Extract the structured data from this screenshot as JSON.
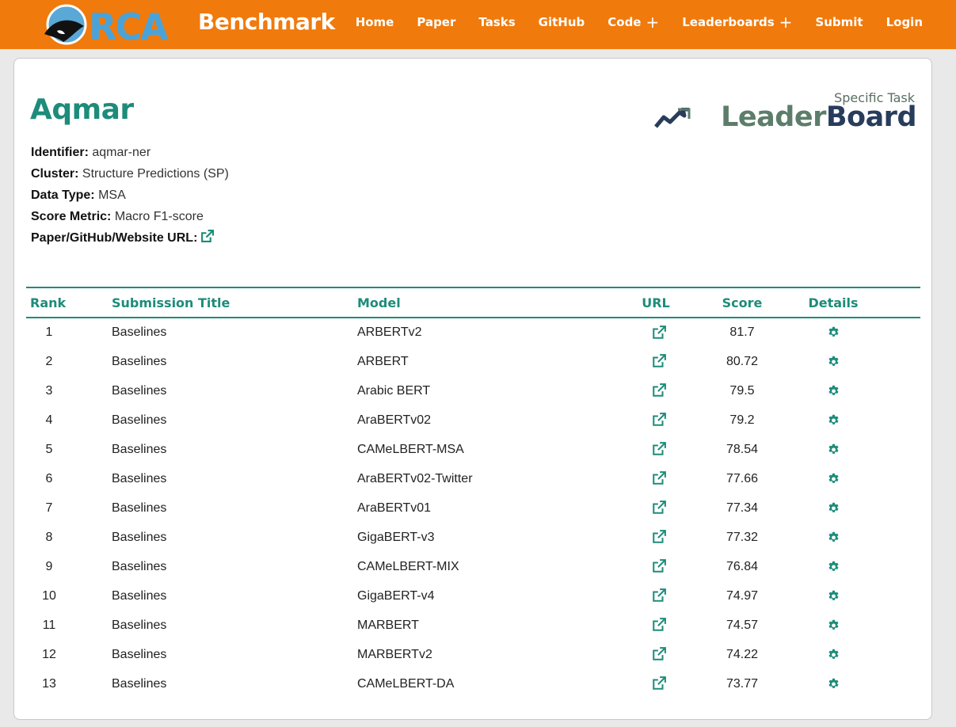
{
  "header": {
    "logo_text": "ORCA",
    "brand": "Benchmark",
    "nav": [
      {
        "label": "Home",
        "has_plus": false
      },
      {
        "label": "Paper",
        "has_plus": false
      },
      {
        "label": "Tasks",
        "has_plus": false
      },
      {
        "label": "GitHub",
        "has_plus": false
      },
      {
        "label": "Code",
        "has_plus": true
      },
      {
        "label": "Leaderboards",
        "has_plus": true
      },
      {
        "label": "Submit",
        "has_plus": false
      },
      {
        "label": "Login",
        "has_plus": false
      }
    ],
    "colors": {
      "bar": "#f07a0c",
      "text": "#ffffff"
    }
  },
  "task": {
    "title": "Aqmar",
    "fields": [
      {
        "label": "Identifier:",
        "value": "aqmar-ner"
      },
      {
        "label": "Cluster:",
        "value": "Structure Predictions (SP)"
      },
      {
        "label": "Data Type:",
        "value": "MSA"
      },
      {
        "label": "Score Metric:",
        "value": "Macro F1-score"
      },
      {
        "label": "Paper/GitHub/Website URL:",
        "value": ""
      }
    ]
  },
  "badge": {
    "small": "Specific Task",
    "word1": "Leader",
    "word2": "Board"
  },
  "table": {
    "headers": {
      "rank": "Rank",
      "title": "Submission Title",
      "model": "Model",
      "url": "URL",
      "score": "Score",
      "details": "Details"
    },
    "rows": [
      {
        "rank": "1",
        "title": "Baselines",
        "model": "ARBERTv2",
        "score": "81.7"
      },
      {
        "rank": "2",
        "title": "Baselines",
        "model": "ARBERT",
        "score": "80.72"
      },
      {
        "rank": "3",
        "title": "Baselines",
        "model": "Arabic BERT",
        "score": "79.5"
      },
      {
        "rank": "4",
        "title": "Baselines",
        "model": "AraBERTv02",
        "score": "79.2"
      },
      {
        "rank": "5",
        "title": "Baselines",
        "model": "CAMeLBERT-MSA",
        "score": "78.54"
      },
      {
        "rank": "6",
        "title": "Baselines",
        "model": "AraBERTv02-Twitter",
        "score": "77.66"
      },
      {
        "rank": "7",
        "title": "Baselines",
        "model": "AraBERTv01",
        "score": "77.34"
      },
      {
        "rank": "8",
        "title": "Baselines",
        "model": "GigaBERT-v3",
        "score": "77.32"
      },
      {
        "rank": "9",
        "title": "Baselines",
        "model": "CAMeLBERT-MIX",
        "score": "76.84"
      },
      {
        "rank": "10",
        "title": "Baselines",
        "model": "GigaBERT-v4",
        "score": "74.97"
      },
      {
        "rank": "11",
        "title": "Baselines",
        "model": "MARBERT",
        "score": "74.57"
      },
      {
        "rank": "12",
        "title": "Baselines",
        "model": "MARBERTv2",
        "score": "74.22"
      },
      {
        "rank": "13",
        "title": "Baselines",
        "model": "CAMeLBERT-DA",
        "score": "73.77"
      }
    ],
    "icons": {
      "url": "external-link-icon",
      "details": "gear-icon"
    },
    "accent": "#1d8c7a"
  }
}
